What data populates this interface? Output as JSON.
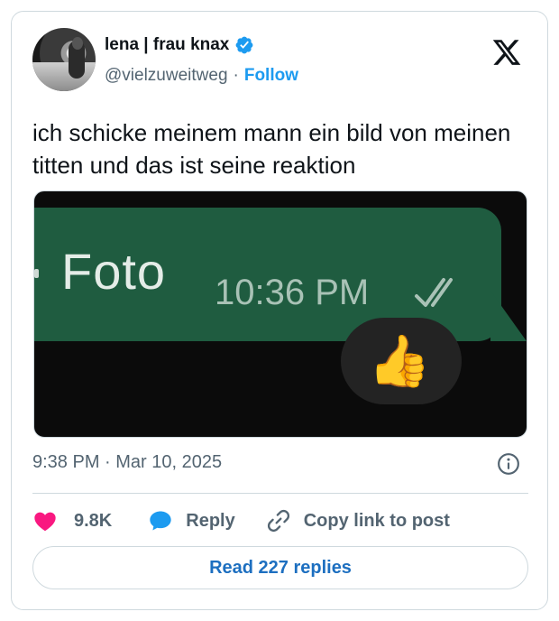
{
  "author": {
    "name": "lena | frau knax",
    "handle": "@vielzuweitweg",
    "separator": "·",
    "follow_label": "Follow",
    "verified": true
  },
  "platform_icon": "x-logo-icon",
  "tweet": {
    "text": "ich schicke meinem mann ein bild von meinen titten und das ist seine reaktion",
    "timestamp": "9:38 PM · Mar 10, 2025"
  },
  "media": {
    "message_label": "Foto",
    "message_time": "10:36 PM",
    "reaction_emoji": "👍",
    "bubble_color": "#1f5c40"
  },
  "actions": {
    "likes": "9.8K",
    "reply_label": "Reply",
    "copy_label": "Copy link to post"
  },
  "read_replies_label": "Read 227 replies",
  "colors": {
    "accent": "#1d9bf0",
    "like": "#f91880",
    "text_secondary": "#536471"
  }
}
